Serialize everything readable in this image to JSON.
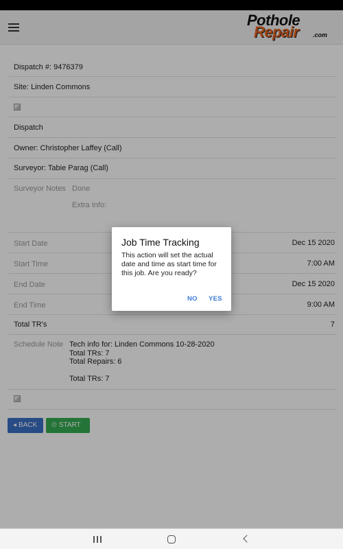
{
  "logo": {
    "line1": "Pothole",
    "line2": "Repair",
    "line3": ".com"
  },
  "job": {
    "dispatch": "Dispatch #: 9476379",
    "site": "Site: Linden Commons",
    "dispatch_label": "Dispatch",
    "owner": "Owner: Christopher Laffey (Call)",
    "surveyor": "Surveyor: Tabie Parag (Call)",
    "surveyor_notes_label": "Surveyor Notes",
    "surveyor_notes_value": "Done",
    "extra_info_label": "Extra Info:",
    "start_date_label": "Start Date",
    "start_date_value": "Dec 15 2020",
    "start_time_label": "Start Time",
    "start_time_value": "7:00 AM",
    "end_date_label": "End Date",
    "end_date_value": "Dec 15 2020",
    "end_time_label": "End Time",
    "end_time_value": "9:00 AM",
    "total_trs_label": "Total TR's",
    "total_trs_value": "7",
    "schedule_note_label": "Schedule Note",
    "schedule_note_lines": [
      "Tech info for: Linden Commons 10-28-2020",
      "Total TRs: 7",
      "Total Repairs: 6",
      "",
      "Total TRs: 7"
    ]
  },
  "buttons": {
    "back": "BACK",
    "start": "START"
  },
  "dialog": {
    "title": "Job Time Tracking",
    "message": "This action will set the actual date and time as start time for this job. Are you ready?",
    "no": "NO",
    "yes": "YES"
  },
  "icons": {
    "menu": "hamburger-menu-icon",
    "back": "caret-left-icon",
    "start": "timer-icon"
  }
}
